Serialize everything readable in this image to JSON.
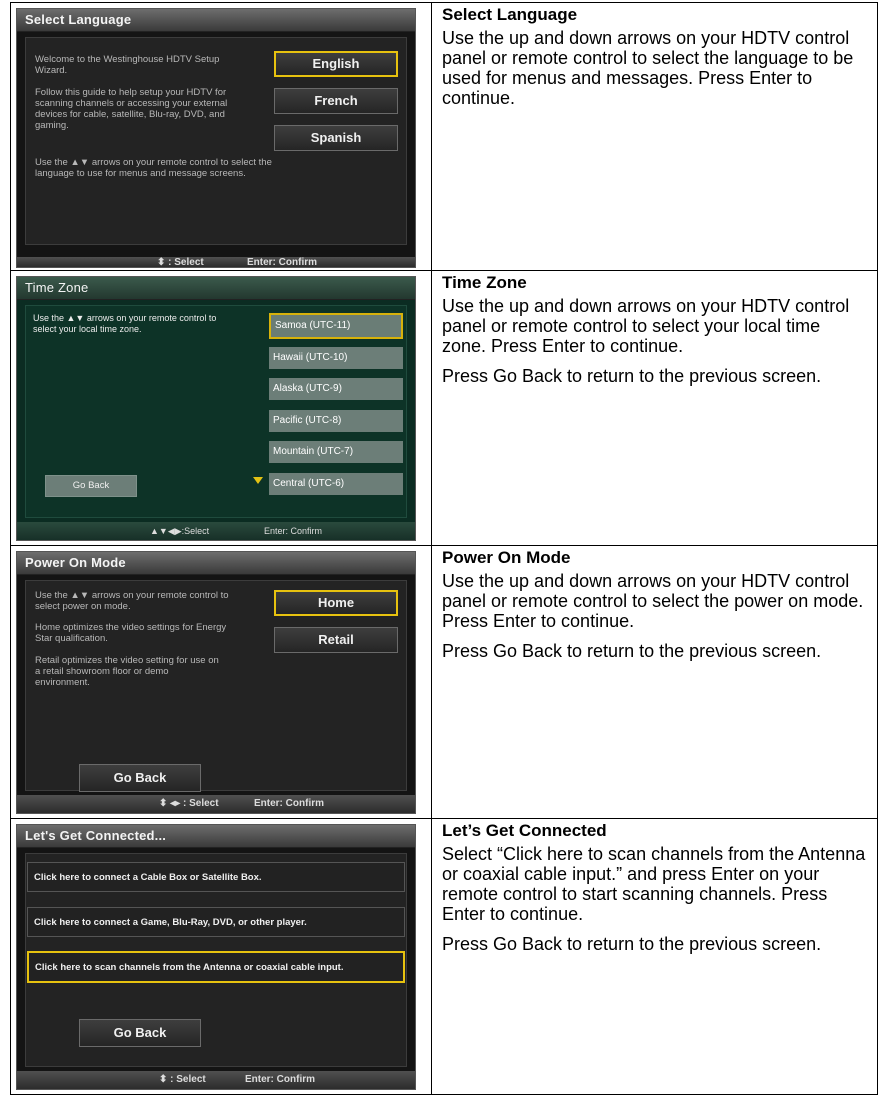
{
  "rows": [
    {
      "screen": {
        "title": "Select Language",
        "description": [
          "Welcome to the Westinghouse HDTV Setup Wizard.",
          "Follow this guide to help setup your HDTV for scanning channels or accessing your external devices for cable, satellite, Blu-ray, DVD, and gaming.",
          "Use the ▲▼ arrows on your remote control to select the language to use for menus and message screens."
        ],
        "options": [
          "English",
          "French",
          "Spanish"
        ],
        "footer_left": "⬍ : Select",
        "footer_right": "Enter: Confirm"
      },
      "heading": "Select Language",
      "paragraphs": [
        "Use the up and down arrows on your HDTV control panel or remote control to select the language to be used for menus and messages. Press Enter to continue."
      ]
    },
    {
      "screen": {
        "title": "Time Zone",
        "description": [
          "Use the ▲▼ arrows on your remote control to select your local time zone."
        ],
        "options": [
          "Samoa (UTC-11)",
          "Hawaii (UTC-10)",
          "Alaska (UTC-9)",
          "Pacific (UTC-8)",
          "Mountain (UTC-7)",
          "Central (UTC-6)"
        ],
        "go_back": "Go Back",
        "footer_left": "▲▼◀▶:Select",
        "footer_right": "Enter: Confirm"
      },
      "heading": "Time Zone",
      "paragraphs": [
        "Use the up and down arrows on your HDTV control panel or remote control to select your local time zone. Press Enter to continue.",
        "Press Go Back to return to the previous screen."
      ]
    },
    {
      "screen": {
        "title": "Power On Mode",
        "description": [
          "Use the ▲▼ arrows on your remote control to select power on mode.",
          "Home optimizes the video settings for Energy Star qualification.",
          "Retail optimizes the video setting for use on a retail showroom floor or demo environment."
        ],
        "options": [
          "Home",
          "Retail"
        ],
        "go_back": "Go Back",
        "footer_left": "⬍ ◂▸ : Select",
        "footer_right": "Enter: Confirm"
      },
      "heading": "Power On Mode",
      "paragraphs": [
        "Use the up and down arrows on your HDTV control panel or remote control to select the power on mode. Press Enter to continue.",
        "Press Go Back to return to the previous screen."
      ]
    },
    {
      "screen": {
        "title": "Let's Get Connected...",
        "options": [
          "Click here to connect a Cable Box or Satellite Box.",
          "Click here to connect a Game, Blu-Ray, DVD, or other player.",
          "Click here to scan channels from the Antenna or coaxial cable input."
        ],
        "go_back": "Go Back",
        "footer_left": "⬍ : Select",
        "footer_right": "Enter: Confirm"
      },
      "heading": "Let’s Get Connected",
      "paragraphs": [
        "Select “Click here to scan channels from the Antenna or coaxial cable input.” and press Enter on your remote control to start scanning channels. Press Enter to continue.",
        "Press Go Back to return to the previous screen."
      ]
    }
  ]
}
